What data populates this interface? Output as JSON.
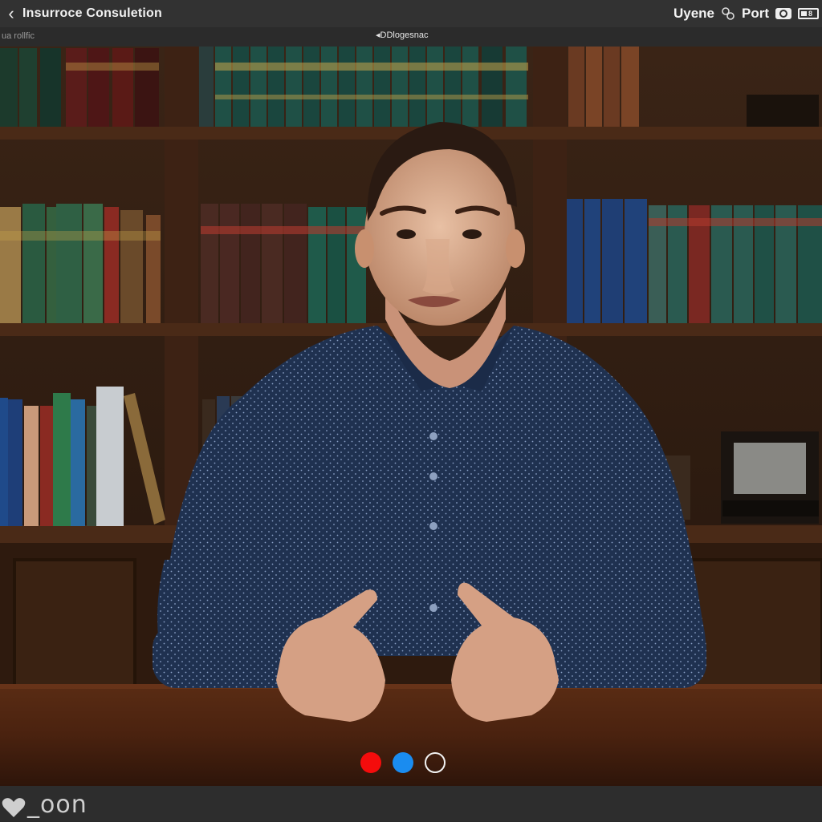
{
  "header": {
    "title": "Insurroce Consuletion",
    "right_label_1": "Uyene",
    "right_label_2": "Port",
    "battery_level": "8"
  },
  "subbar": {
    "left_text": "ua rollfic",
    "center_text": "◂DDlogesnac"
  },
  "controls": {
    "dots": [
      "red",
      "blue",
      "white-outline"
    ]
  },
  "footer": {
    "text": "_oon"
  },
  "colors": {
    "red_dot": "#f40c0c",
    "blue_dot": "#1a8cf0",
    "bar_bg": "#323232"
  },
  "icons": [
    "back-chevron-icon",
    "sync-icon",
    "cc-icon",
    "battery-icon",
    "heart-icon"
  ]
}
